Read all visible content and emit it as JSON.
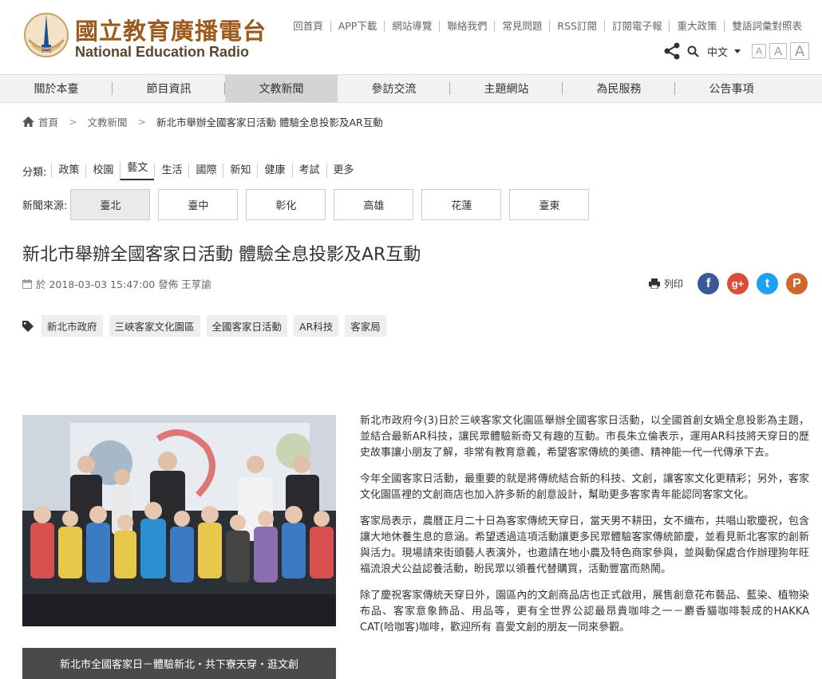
{
  "header": {
    "logo_cn": "國立教育廣播電台",
    "logo_en": "National Education Radio",
    "top_links": [
      "回首頁",
      "APP下載",
      "網站導覽",
      "聯絡我們",
      "常見問題",
      "RSS訂閱",
      "訂閱電子報",
      "重大政策",
      "雙語詞彙對照表"
    ],
    "lang": "中文",
    "font_sizes": [
      "A",
      "A",
      "A"
    ]
  },
  "nav": {
    "items": [
      "關於本臺",
      "節目資訊",
      "文教新聞",
      "參訪交流",
      "主題網站",
      "為民服務",
      "公告事項"
    ],
    "active_index": 2
  },
  "breadcrumb": {
    "home": "首頁",
    "sep": ">",
    "section": "文教新聞",
    "current": "新北市舉辦全國客家日活動 體驗全息投影及AR互動"
  },
  "categories": {
    "label": "分類:",
    "items": [
      "政策",
      "校園",
      "藝文",
      "生活",
      "國際",
      "新知",
      "健康",
      "考試",
      "更多"
    ],
    "active_index": 2
  },
  "sources": {
    "label": "新聞來源:",
    "items": [
      "臺北",
      "臺中",
      "彰化",
      "高雄",
      "花蓮",
      "臺東"
    ],
    "active_index": 0
  },
  "article": {
    "title": "新北市舉辦全國客家日活動 體驗全息投影及AR互動",
    "meta": "於 2018-03-03 15:47:00 發佈 王莩諭",
    "print_label": "列印",
    "tags": [
      "新北市政府",
      "三峽客家文化園區",
      "全國客家日活動",
      "AR科技",
      "客家局"
    ],
    "caption": "新北市全國客家日－體驗新北・共下寮天穿・逛文創",
    "paragraphs": [
      "新北市政府今(3)日於三峽客家文化園區舉辦全國客家日活動，以全國首創女媧全息投影為主題，並結合最新AR科技，讓民眾體驗新奇又有趣的互動。市長朱立倫表示，運用AR科技將天穿日的歷史故事讓小朋友了解，非常有教育意義，希望客家傳統的美德、精神能一代一代傳承下去。",
      "今年全國客家日活動，最重要的就是將傳統結合新的科技、文創，讓客家文化更精彩；另外，客家文化園區裡的文創商店也加入許多新的創意設計，幫助更多客家青年能認同客家文化。",
      "客家局表示，農曆正月二十日為客家傳統天穿日，當天男不耕田，女不織布，共唱山歌慶祝，包含讓大地休養生息的意涵。希望透過這項活動讓更多民眾體驗客家傳統節慶，並看見新北客家的創新與活力。現場請來街頭藝人表演外，也邀請在地小農及特色商家參與，並與動保處合作辦理狗年旺福流浪犬公益認養活動，盼民眾以領養代替購買，活動豐富而熱鬧。",
      "除了慶祝客家傳統天穿日外，園區內的文創商品店也正式啟用，展售創意花布藝品、藍染、植物染布品、客家意象飾品、用品等，更有全世界公認最昂貴咖啡之一－麝香貓咖啡製成的HAKKA CAT(哈咖客)咖啡，歡迎所有 喜愛文創的朋友一同來參觀。"
    ]
  },
  "social": [
    {
      "name": "facebook",
      "glyph": "f",
      "color": "#3b5998"
    },
    {
      "name": "google-plus",
      "glyph": "g+",
      "color": "#dd4b39"
    },
    {
      "name": "twitter",
      "glyph": "t",
      "color": "#1da1f2"
    },
    {
      "name": "plurk",
      "glyph": "P",
      "color": "#cf682f"
    }
  ]
}
